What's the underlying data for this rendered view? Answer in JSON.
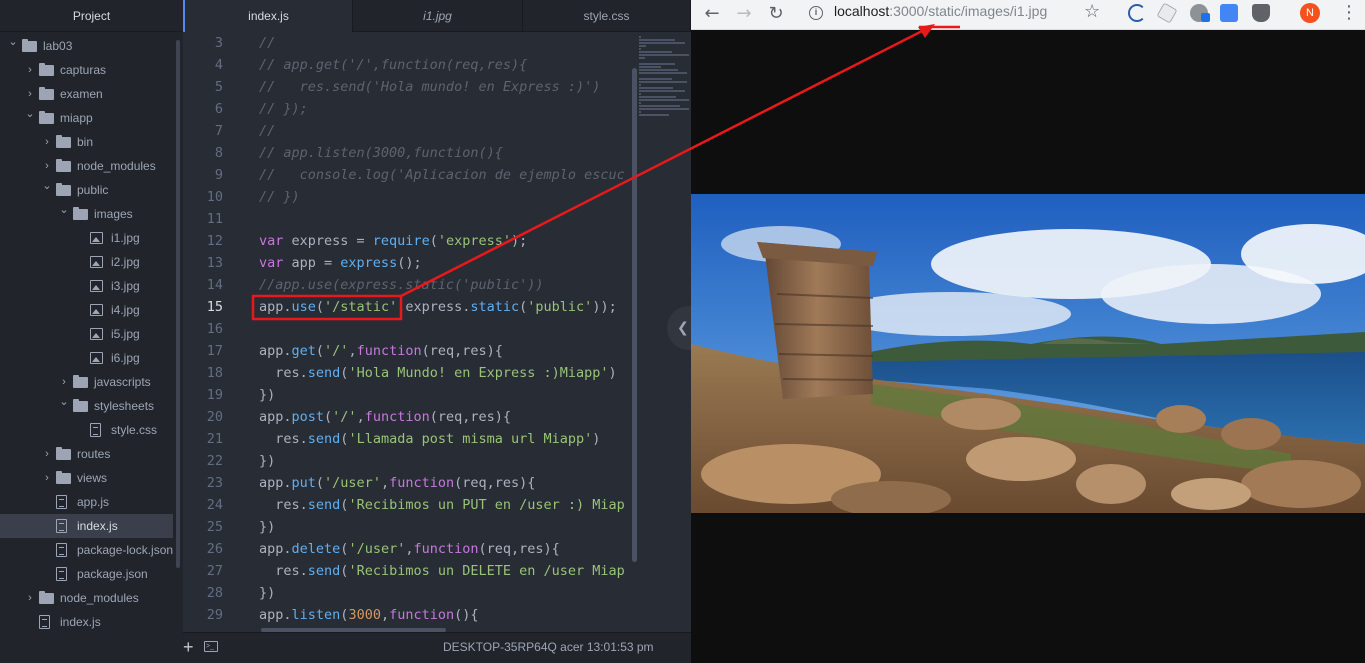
{
  "atom": {
    "tree": {
      "header": "Project",
      "items": [
        {
          "label": "lab03",
          "type": "folder",
          "expanded": true,
          "depth": 0
        },
        {
          "label": "capturas",
          "type": "folder",
          "expanded": false,
          "depth": 1
        },
        {
          "label": "examen",
          "type": "folder",
          "expanded": false,
          "depth": 1
        },
        {
          "label": "miapp",
          "type": "folder",
          "expanded": true,
          "depth": 1
        },
        {
          "label": "bin",
          "type": "folder",
          "expanded": false,
          "depth": 2
        },
        {
          "label": "node_modules",
          "type": "folder",
          "expanded": false,
          "depth": 2
        },
        {
          "label": "public",
          "type": "folder",
          "expanded": true,
          "depth": 2
        },
        {
          "label": "images",
          "type": "folder",
          "expanded": true,
          "depth": 3
        },
        {
          "label": "i1.jpg",
          "type": "image",
          "depth": 4
        },
        {
          "label": "i2.jpg",
          "type": "image",
          "depth": 4
        },
        {
          "label": "i3.jpg",
          "type": "image",
          "depth": 4
        },
        {
          "label": "i4.jpg",
          "type": "image",
          "depth": 4
        },
        {
          "label": "i5.jpg",
          "type": "image",
          "depth": 4
        },
        {
          "label": "i6.jpg",
          "type": "image",
          "depth": 4
        },
        {
          "label": "javascripts",
          "type": "folder",
          "expanded": false,
          "depth": 3
        },
        {
          "label": "stylesheets",
          "type": "folder",
          "expanded": true,
          "depth": 3
        },
        {
          "label": "style.css",
          "type": "file",
          "depth": 4
        },
        {
          "label": "routes",
          "type": "folder",
          "expanded": false,
          "depth": 2
        },
        {
          "label": "views",
          "type": "folder",
          "expanded": false,
          "depth": 2
        },
        {
          "label": "app.js",
          "type": "file",
          "depth": 2
        },
        {
          "label": "index.js",
          "type": "file",
          "depth": 2,
          "selected": true
        },
        {
          "label": "package-lock.json",
          "type": "file",
          "depth": 2
        },
        {
          "label": "package.json",
          "type": "file",
          "depth": 2
        },
        {
          "label": "node_modules",
          "type": "folder",
          "expanded": false,
          "depth": 1
        },
        {
          "label": "index.js",
          "type": "file",
          "depth": 1
        }
      ]
    },
    "tabs": [
      {
        "label": "index.js",
        "active": true
      },
      {
        "label": "i1.jpg",
        "active": false
      },
      {
        "label": "style.css",
        "active": false
      }
    ],
    "editor": {
      "current_line": 15,
      "lines": [
        {
          "n": 3,
          "tokens": [
            [
              "cm",
              "//"
            ]
          ]
        },
        {
          "n": 4,
          "tokens": [
            [
              "cm",
              "// app.get('/',function(req,res){"
            ]
          ]
        },
        {
          "n": 5,
          "tokens": [
            [
              "cm",
              "//   res.send('Hola mundo! en Express :)')"
            ]
          ]
        },
        {
          "n": 6,
          "tokens": [
            [
              "cm",
              "// });"
            ]
          ]
        },
        {
          "n": 7,
          "tokens": [
            [
              "cm",
              "//"
            ]
          ]
        },
        {
          "n": 8,
          "tokens": [
            [
              "cm",
              "// app.listen(3000,function(){"
            ]
          ]
        },
        {
          "n": 9,
          "tokens": [
            [
              "cm",
              "//   console.log('Aplicacion de ejemplo escuc"
            ]
          ]
        },
        {
          "n": 10,
          "tokens": [
            [
              "cm",
              "// })"
            ]
          ]
        },
        {
          "n": 11,
          "tokens": []
        },
        {
          "n": 12,
          "tokens": [
            [
              "kw",
              "var"
            ],
            [
              "pl",
              " express = "
            ],
            [
              "fn",
              "require"
            ],
            [
              "pl",
              "("
            ],
            [
              "str",
              "'express'"
            ],
            [
              "pl",
              ");"
            ]
          ]
        },
        {
          "n": 13,
          "tokens": [
            [
              "kw",
              "var"
            ],
            [
              "pl",
              " app = "
            ],
            [
              "fn",
              "express"
            ],
            [
              "pl",
              "();"
            ]
          ]
        },
        {
          "n": 14,
          "tokens": [
            [
              "cm",
              "//app.use(express.static('public'))"
            ]
          ]
        },
        {
          "n": 15,
          "tokens": [
            [
              "pl",
              "app."
            ],
            [
              "fn",
              "use"
            ],
            [
              "pl",
              "("
            ],
            [
              "str",
              "'/static'"
            ],
            [
              "pl",
              ",express."
            ],
            [
              "fn",
              "static"
            ],
            [
              "pl",
              "("
            ],
            [
              "str",
              "'public'"
            ],
            [
              "pl",
              "));"
            ]
          ]
        },
        {
          "n": 16,
          "tokens": []
        },
        {
          "n": 17,
          "tokens": [
            [
              "pl",
              "app."
            ],
            [
              "fn",
              "get"
            ],
            [
              "pl",
              "("
            ],
            [
              "str",
              "'/'"
            ],
            [
              "pl",
              ","
            ],
            [
              "kw",
              "function"
            ],
            [
              "pl",
              "(req,res){"
            ]
          ]
        },
        {
          "n": 18,
          "tokens": [
            [
              "pl",
              "  res."
            ],
            [
              "fn",
              "send"
            ],
            [
              "pl",
              "("
            ],
            [
              "str",
              "'Hola Mundo! en Express :)Miapp'"
            ],
            [
              "pl",
              ")"
            ]
          ]
        },
        {
          "n": 19,
          "tokens": [
            [
              "pl",
              "})"
            ]
          ]
        },
        {
          "n": 20,
          "tokens": [
            [
              "pl",
              "app."
            ],
            [
              "fn",
              "post"
            ],
            [
              "pl",
              "("
            ],
            [
              "str",
              "'/'"
            ],
            [
              "pl",
              ","
            ],
            [
              "kw",
              "function"
            ],
            [
              "pl",
              "(req,res){"
            ]
          ]
        },
        {
          "n": 21,
          "tokens": [
            [
              "pl",
              "  res."
            ],
            [
              "fn",
              "send"
            ],
            [
              "pl",
              "("
            ],
            [
              "str",
              "'Llamada post misma url Miapp'"
            ],
            [
              "pl",
              ")"
            ]
          ]
        },
        {
          "n": 22,
          "tokens": [
            [
              "pl",
              "})"
            ]
          ]
        },
        {
          "n": 23,
          "tokens": [
            [
              "pl",
              "app."
            ],
            [
              "fn",
              "put"
            ],
            [
              "pl",
              "("
            ],
            [
              "str",
              "'/user'"
            ],
            [
              "pl",
              ","
            ],
            [
              "kw",
              "function"
            ],
            [
              "pl",
              "(req,res){"
            ]
          ]
        },
        {
          "n": 24,
          "tokens": [
            [
              "pl",
              "  res."
            ],
            [
              "fn",
              "send"
            ],
            [
              "pl",
              "("
            ],
            [
              "str",
              "'Recibimos un PUT en /user :) Miap"
            ]
          ]
        },
        {
          "n": 25,
          "tokens": [
            [
              "pl",
              "})"
            ]
          ]
        },
        {
          "n": 26,
          "tokens": [
            [
              "pl",
              "app."
            ],
            [
              "fn",
              "delete"
            ],
            [
              "pl",
              "("
            ],
            [
              "str",
              "'/user'"
            ],
            [
              "pl",
              ","
            ],
            [
              "kw",
              "function"
            ],
            [
              "pl",
              "(req,res){"
            ]
          ]
        },
        {
          "n": 27,
          "tokens": [
            [
              "pl",
              "  res."
            ],
            [
              "fn",
              "send"
            ],
            [
              "pl",
              "("
            ],
            [
              "str",
              "'Recibimos un DELETE en /user Miap"
            ]
          ]
        },
        {
          "n": 28,
          "tokens": [
            [
              "pl",
              "})"
            ]
          ]
        },
        {
          "n": 29,
          "tokens": [
            [
              "pl",
              "app."
            ],
            [
              "fn",
              "listen"
            ],
            [
              "pl",
              "("
            ],
            [
              "num",
              "3000"
            ],
            [
              "pl",
              ","
            ],
            [
              "kw",
              "function"
            ],
            [
              "pl",
              "(){"
            ]
          ]
        }
      ]
    },
    "status_bar": {
      "text": "DESKTOP-35RP64Q acer 13:01:53 pm"
    }
  },
  "browser": {
    "url_host": "localhost",
    "url_rest": ":3000/static/images/i1.jpg",
    "avatar_letter": "N",
    "accent": "#f4511e"
  },
  "annotation": {
    "color": "#e8191b"
  }
}
